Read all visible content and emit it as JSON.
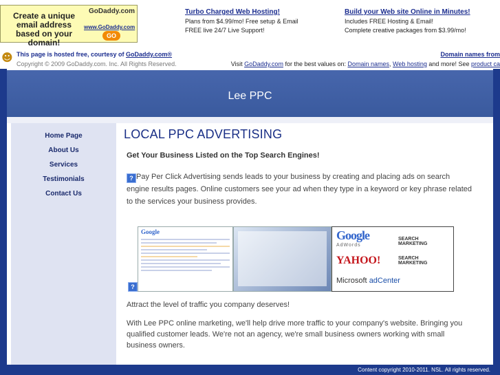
{
  "ad": {
    "left_text": "Create a unique email address based on your domain!",
    "logo": "GoDaddy.com",
    "url": "www.GoDaddy.com",
    "go": "GO",
    "col1": {
      "link": "Turbo Charged Web Hosting!",
      "line1": "Plans from $4.99/mo! Free setup & Email",
      "line2": "FREE live 24/7 Live Support!"
    },
    "col2": {
      "link": "Build your Web site Online in Minutes!",
      "line1": "Includes FREE Hosting & Email!",
      "line2": "Complete creative packages from $3.99/mo!"
    }
  },
  "hostbar": {
    "line1_prefix": "This page is hosted free, courtesy of ",
    "line1_link": "GoDaddy.com®",
    "line2": "Copyright © 2009 GoDaddy.com. Inc. All Rights Reserved.",
    "right1": "Domain names from",
    "right2_prefix": "Visit ",
    "right2_link1": "GoDaddy.com",
    "right2_mid": " for the best values on: ",
    "right2_link2": "Domain names",
    "right2_sep": ", ",
    "right2_link3": "Web hosting",
    "right2_end": " and more! See ",
    "right2_link4": "product ca"
  },
  "site": {
    "title": "Lee PPC"
  },
  "nav": [
    "Home Page",
    "About Us",
    "Services",
    "Testimonials",
    "Contact Us"
  ],
  "content": {
    "title": "LOCAL PPC ADVERTISING",
    "subtitle": "Get Your Business Listed on the Top Search Engines!",
    "para1": "Pay Per Click Advertising sends leads to your business by creating and placing ads on search engine results pages. Online customers see your ad when they type in a keyword or key phrase related to the services your business provides.",
    "attract": "Attract the level of traffic you company deserves!",
    "para2": "With Lee PPC online marketing, we'll help drive more traffic to your company's website. Bringing you qualified customer leads. We're not an agency, we're small business owners working with small business owners."
  },
  "img3": {
    "google": "Google",
    "adwords": "AdWords",
    "yahoo": "YAHOO!",
    "yahoo_sub": "SEARCH MARKETING",
    "ms": "Microsoft",
    "adcenter": "adCenter"
  },
  "footer": {
    "copyright": "Content copyright 2010-2011. NSL. All rights reserved."
  },
  "icon_char": "?"
}
